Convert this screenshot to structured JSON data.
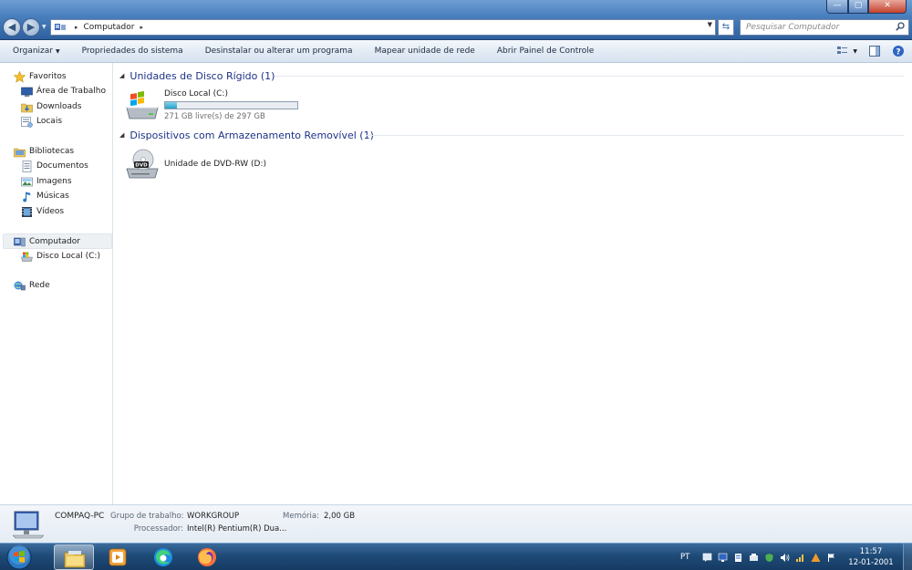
{
  "window": {
    "address": {
      "location": "Computador",
      "sep": "▸"
    },
    "search_placeholder": "Pesquisar Computador",
    "controls": {
      "minimize": "—",
      "maximize": "▢",
      "close": "✕"
    }
  },
  "toolbar": {
    "organize": "Organizar",
    "items": [
      "Propriedades do sistema",
      "Desinstalar ou alterar um programa",
      "Mapear unidade de rede",
      "Abrir Painel de Controle"
    ]
  },
  "nav": {
    "favorites": "Favoritos",
    "desktop": "Área de Trabalho",
    "downloads": "Downloads",
    "places": "Locais",
    "libraries": "Bibliotecas",
    "documents": "Documentos",
    "images": "Imagens",
    "music": "Músicas",
    "videos": "Vídeos",
    "computer": "Computador",
    "local_disk": "Disco Local (C:)",
    "network": "Rede"
  },
  "content": {
    "hard_disks_header": "Unidades de Disco Rígido (1)",
    "removable_header": "Dispositivos com Armazenamento Removível (1)",
    "local_disk": {
      "name": "Disco Local (C:)",
      "free_text": "271 GB livre(s) de 297 GB",
      "used_fraction": 0.0875
    },
    "dvd": {
      "name": "Unidade de DVD-RW (D:)",
      "badge": "DVD"
    }
  },
  "details": {
    "pc_name": "COMPAQ-PC",
    "workgroup_label": "Grupo de trabalho:",
    "workgroup_value": "WORKGROUP",
    "memory_label": "Memória:",
    "memory_value": "2,00 GB",
    "processor_label": "Processador:",
    "processor_value": "Intel(R) Pentium(R) Dua..."
  },
  "taskbar": {
    "language": "PT",
    "time": "11:57",
    "date": "12-01-2001"
  },
  "colors": {
    "accent": "#1e3287",
    "disk_fill": "#27a3c9",
    "taskbar": "#1e4a77"
  }
}
